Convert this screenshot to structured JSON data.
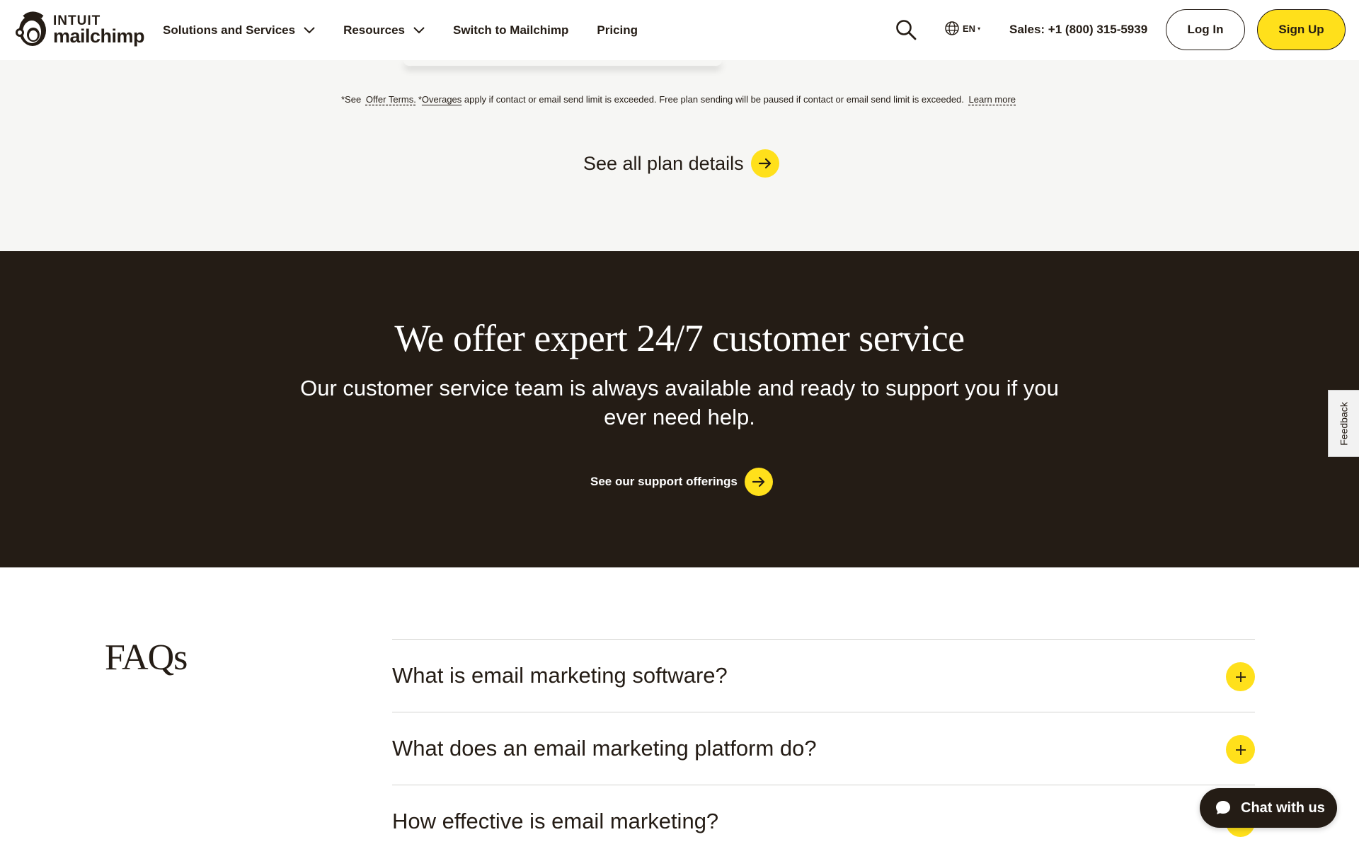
{
  "brand": {
    "top": "INTUIT",
    "bottom": "mailchimp"
  },
  "nav": {
    "items": [
      {
        "label": "Solutions and Services",
        "has_dropdown": true
      },
      {
        "label": "Resources",
        "has_dropdown": true
      },
      {
        "label": "Switch to Mailchimp",
        "has_dropdown": false
      },
      {
        "label": "Pricing",
        "has_dropdown": false
      }
    ]
  },
  "header": {
    "language": "EN",
    "sales": "Sales: +1 (800) 315-5939",
    "login_label": "Log In",
    "signup_label": "Sign Up"
  },
  "plans": {
    "disclaimer_prefix": "*See",
    "offer_terms": "Offer Terms.",
    "overages_prefix": "*",
    "overages": "Overages",
    "disclaimer_text": "apply if contact or email send limit is exceeded. Free plan sending will be paused if contact or email send limit is exceeded.",
    "learn_more": "Learn more",
    "see_all": "See all plan details"
  },
  "support": {
    "title": "We offer expert 24/7 customer service",
    "body": "Our customer service team is always available and ready to support you if you ever need help.",
    "link": "See our support offerings"
  },
  "faq": {
    "title": "FAQs",
    "questions": [
      "What is email marketing software?",
      "What does an email marketing platform do?",
      "How effective is email marketing?"
    ]
  },
  "widgets": {
    "feedback": "Feedback",
    "chat": "Chat with us"
  },
  "colors": {
    "accent_yellow": "#ffe01b",
    "dark": "#241c15",
    "light_band": "#f6f6f4"
  }
}
